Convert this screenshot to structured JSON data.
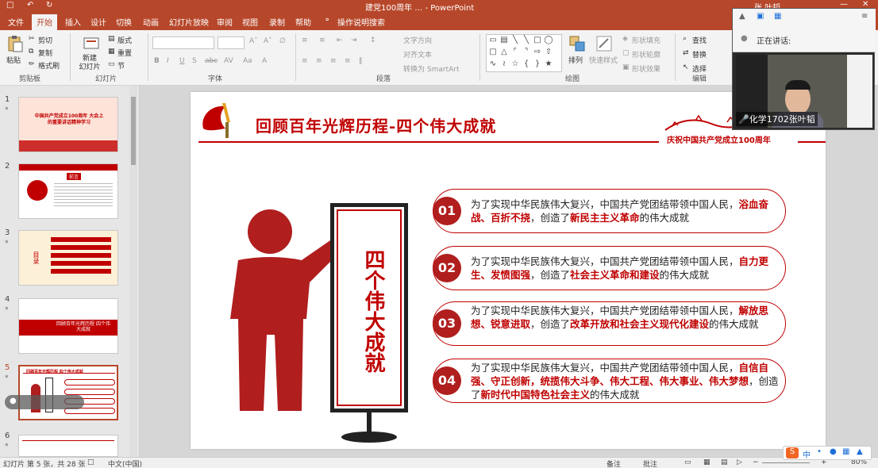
{
  "window": {
    "doc_title": "建党100周年 … - PowerPoint",
    "user_name": "张 叶韬"
  },
  "ribbon_tabs": [
    "文件",
    "开始",
    "插入",
    "设计",
    "切换",
    "动画",
    "幻灯片放映",
    "审阅",
    "视图",
    "录制",
    "帮助",
    "操作说明搜索"
  ],
  "ribbon": {
    "paste": "粘贴",
    "cut": "剪切",
    "copy": "复制",
    "format_painter": "格式刷",
    "clipboard_group": "剪贴板",
    "new_slide": "新建\n幻灯片",
    "layout": "版式",
    "reset": "重置",
    "section": "节",
    "slides_group": "幻灯片",
    "font_group": "字体",
    "text_direction": "文字方向",
    "align_text": "对齐文本",
    "smartart": "转换为 SmartArt",
    "paragraph_group": "段落",
    "arrange": "排列",
    "quick_styles": "快速样式",
    "shape_fill": "形状填充",
    "shape_outline": "形状轮廓",
    "shape_effects": "形状效果",
    "drawing_group": "绘图",
    "find": "查找",
    "replace": "替换",
    "select": "选择",
    "editing_group": "编辑"
  },
  "thumbnails": [
    {
      "num": "1",
      "text": "中国共产党成立100周年 大会上的重要讲话精神学习"
    },
    {
      "num": "2",
      "text": "前言"
    },
    {
      "num": "3",
      "text": "目录"
    },
    {
      "num": "4",
      "text": "回顾百年光辉历程 四个伟大成就"
    },
    {
      "num": "5",
      "text": "回顾百年光辉历程 四个伟大成就"
    },
    {
      "num": "6",
      "text": ""
    }
  ],
  "slide": {
    "title": "回顾百年光辉历程-四个伟大成就",
    "subtitle": "庆祝中国共产党成立100周年",
    "banner_chars": "四个伟大成就",
    "items": [
      {
        "num": "01",
        "lead": "为了实现中华民族伟大复兴，中国共产党团结带领中国人民，",
        "hl1": "浴血奋战、百折不挠",
        "mid": "，创造了",
        "hl2": "新民主主义革命",
        "tail": "的伟大成就"
      },
      {
        "num": "02",
        "lead": "为了实现中华民族伟大复兴，中国共产党团结带领中国人民，",
        "hl1": "自力更生、发愤图强",
        "mid": "，创造了",
        "hl2": "社会主义革命和建设",
        "tail": "的伟大成就"
      },
      {
        "num": "03",
        "lead": "为了实现中华民族伟大复兴，中国共产党团结带领中国人民，",
        "hl1": "解放思想、锐意进取",
        "mid": "，创造了",
        "hl2": "改革开放和社会主义现代化建设",
        "tail": "的伟大成就"
      },
      {
        "num": "04",
        "lead": "为了实现中华民族伟大复兴，中国共产党团结带领中国人民，",
        "hl1": "自信自强、守正创新，统揽伟大斗争、伟大工程、伟大事业、伟大梦想",
        "mid": "，创造了",
        "hl2": "新时代中国特色社会主义",
        "tail": "的伟大成就"
      }
    ]
  },
  "video": {
    "speaking_label": "正在讲话:",
    "participant": "化学1702张叶韬"
  },
  "status": {
    "slide_info": "幻灯片 第 5 张，共 28 张",
    "language": "中文(中国)",
    "notes": "备注",
    "comments": "批注",
    "zoom": "80%"
  },
  "colors": {
    "brand": "#b7472a",
    "accent_red": "#c00000"
  }
}
